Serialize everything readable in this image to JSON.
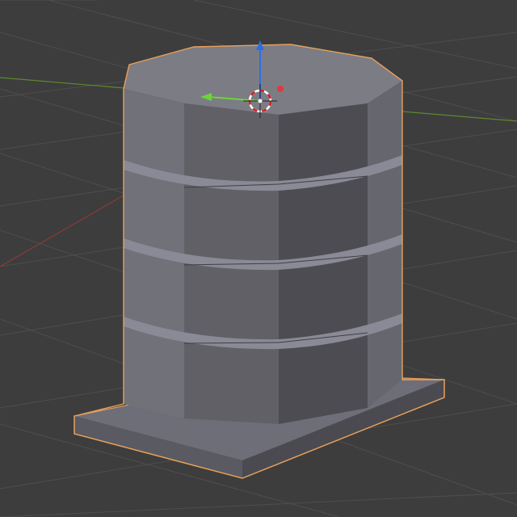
{
  "viewport": {
    "background": "#3d3d3d",
    "grid_color": "#4e4e4e",
    "x_axis_color": "#8a3a3a",
    "y_axis_color": "#5c8a2c"
  },
  "object": {
    "face_top": "#7c7c85",
    "face_light": "#717179",
    "face_mid": "#606066",
    "face_dark": "#4c4c52",
    "selection_outline": "#e8a05a",
    "groove": "#8a8a96"
  },
  "gizmo": {
    "z_axis_color": "#2e6fe0",
    "y_axis_color": "#6cd43a",
    "x_axis_color": "#e03a3a",
    "cursor_icon": "3d-cursor-icon"
  }
}
